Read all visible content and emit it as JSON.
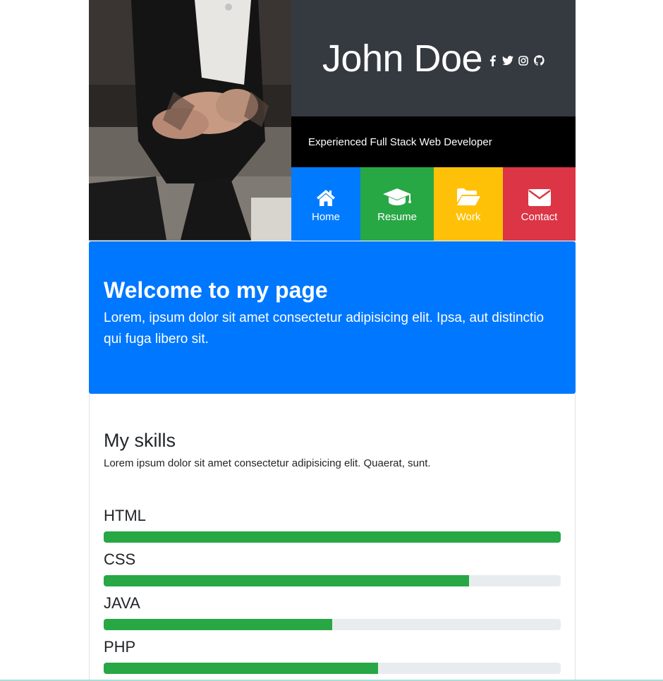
{
  "header": {
    "name": "John Doe",
    "tagline": "Experienced Full Stack Web Developer",
    "social_icons": [
      "facebook-icon",
      "twitter-icon",
      "instagram-icon",
      "github-icon"
    ]
  },
  "nav": {
    "items": [
      {
        "label": "Home",
        "icon": "home-icon",
        "color": "#007bff"
      },
      {
        "label": "Resume",
        "icon": "graduation-cap-icon",
        "color": "#28a745"
      },
      {
        "label": "Work",
        "icon": "folder-open-icon",
        "color": "#ffc107"
      },
      {
        "label": "Contact",
        "icon": "envelope-icon",
        "color": "#dc3545"
      }
    ]
  },
  "welcome": {
    "title": "Welcome to my page",
    "text": "Lorem, ipsum dolor sit amet consectetur adipisicing elit. Ipsa, aut distinctio qui fuga libero sit.",
    "color": "#0077ff"
  },
  "skills": {
    "title": "My skills",
    "description": "Lorem ipsum dolor sit amet consectetur adipisicing elit. Quaerat, sunt.",
    "bar_color": "#28a745",
    "items": [
      {
        "label": "HTML",
        "percent": 100
      },
      {
        "label": "CSS",
        "percent": 80
      },
      {
        "label": "JAVA",
        "percent": 50
      },
      {
        "label": "PHP",
        "percent": 60
      }
    ]
  }
}
